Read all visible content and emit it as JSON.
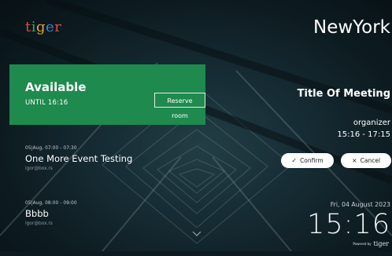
{
  "logo": {
    "letters": [
      "t",
      "i",
      "g",
      "e",
      "r"
    ]
  },
  "status": {
    "label": "Available",
    "until": "UNTIL 16:16",
    "reserve_label": "Reserve room"
  },
  "events": [
    {
      "time": "05|Aug, 07:00 - 07:30",
      "title": "One More Event Testing",
      "email": "igor@box.rs"
    },
    {
      "time": "05|Aug, 08:00 - 09:00",
      "title": "Bbbb",
      "email": "igor@box.rs"
    }
  ],
  "room": {
    "name": "NewYork"
  },
  "meeting": {
    "title": "Title Of Meeting",
    "organizer": "organizer",
    "time": "15:16 - 17:15"
  },
  "actions": {
    "confirm_label": "Confirm",
    "cancel_label": "Cancel",
    "confirm_icon": "check-icon",
    "cancel_icon": "close-icon"
  },
  "datetime": {
    "date": "Fri, 04 August 2023",
    "clock": "15:16"
  },
  "footer": {
    "powered": "Powered by",
    "brand": "tiger"
  },
  "colors": {
    "available": "#1e8a4e",
    "background": "#13272e"
  }
}
